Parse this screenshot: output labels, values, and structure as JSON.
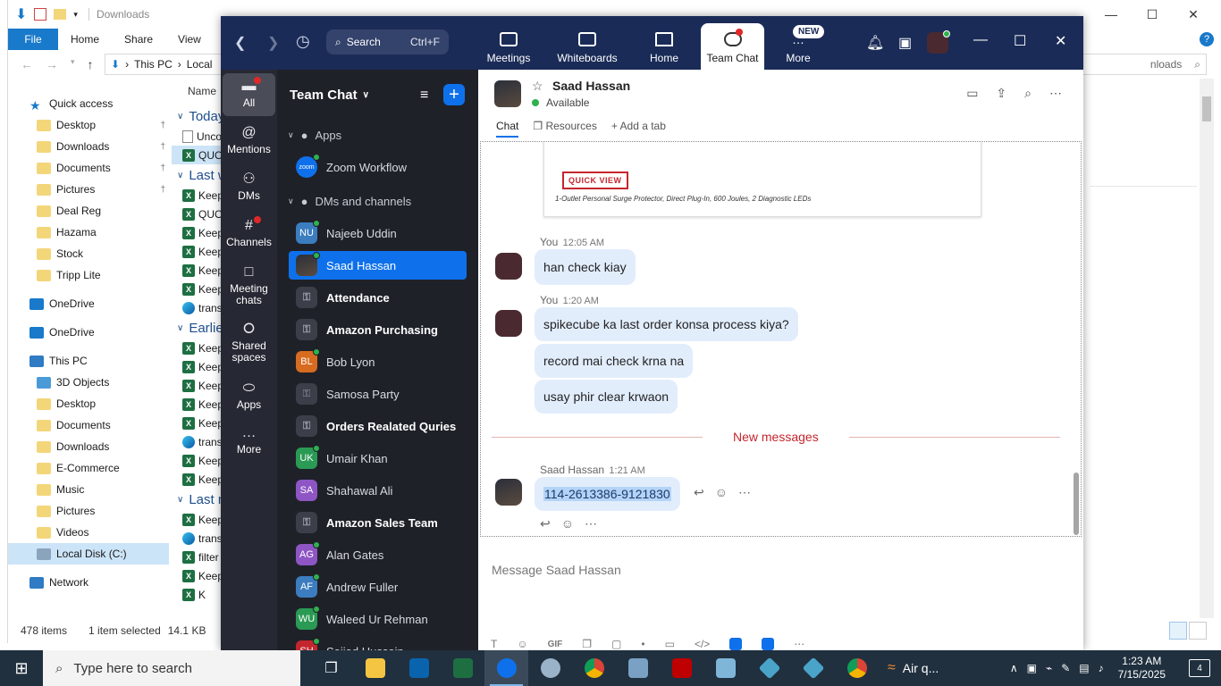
{
  "explorer": {
    "title": "Downloads",
    "ribbon_tabs": [
      "File",
      "Home",
      "Share",
      "View"
    ],
    "help_icon": "?",
    "address": [
      "This PC",
      "Local"
    ],
    "search_placeholder": "nloads",
    "nav": [
      {
        "label": "Quick access",
        "icon": "star-icon",
        "sub": false
      },
      {
        "label": "Desktop",
        "icon": "desktop-folder-icon",
        "sub": true,
        "pinned": true
      },
      {
        "label": "Downloads",
        "icon": "downloads-folder-icon",
        "sub": true,
        "pinned": true
      },
      {
        "label": "Documents",
        "icon": "documents-folder-icon",
        "sub": true,
        "pinned": true
      },
      {
        "label": "Pictures",
        "icon": "pictures-folder-icon",
        "sub": true,
        "pinned": true
      },
      {
        "label": "Deal Reg",
        "icon": "folder-icon",
        "sub": true
      },
      {
        "label": "Hazama",
        "icon": "folder-icon",
        "sub": true
      },
      {
        "label": "Stock",
        "icon": "folder-icon",
        "sub": true
      },
      {
        "label": "Tripp Lite",
        "icon": "folder-icon",
        "sub": true
      },
      {
        "label": "OneDrive",
        "icon": "cloud-icon",
        "sub": false
      },
      {
        "label": "OneDrive",
        "icon": "cloud-icon",
        "sub": false
      },
      {
        "label": "This PC",
        "icon": "pc-icon",
        "sub": false
      },
      {
        "label": "3D Objects",
        "icon": "3d-objects-icon",
        "sub": true
      },
      {
        "label": "Desktop",
        "icon": "desktop-folder-icon",
        "sub": true
      },
      {
        "label": "Documents",
        "icon": "documents-folder-icon",
        "sub": true
      },
      {
        "label": "Downloads",
        "icon": "downloads-folder-icon",
        "sub": true
      },
      {
        "label": "E-Commerce",
        "icon": "folder-icon",
        "sub": true
      },
      {
        "label": "Music",
        "icon": "music-folder-icon",
        "sub": true
      },
      {
        "label": "Pictures",
        "icon": "pictures-folder-icon",
        "sub": true
      },
      {
        "label": "Videos",
        "icon": "videos-folder-icon",
        "sub": true
      },
      {
        "label": "Local Disk (C:)",
        "icon": "drive-icon",
        "sub": true,
        "selected": true
      },
      {
        "label": "Network",
        "icon": "network-icon",
        "sub": false
      }
    ],
    "list_header": "Name",
    "groups": {
      "today": "Today",
      "last_week": "Last w",
      "earlier": "Earlie",
      "last_month": "Last m"
    },
    "today_items": [
      {
        "label": "Unco",
        "type": "file"
      },
      {
        "label": "QUO",
        "type": "xl",
        "selected": true
      }
    ],
    "last_week_items": [
      {
        "label": "Keep",
        "type": "xl"
      },
      {
        "label": "QUO",
        "type": "xl"
      },
      {
        "label": "Keep",
        "type": "xl"
      },
      {
        "label": "Keep",
        "type": "xl"
      },
      {
        "label": "Keep",
        "type": "xl"
      },
      {
        "label": "Keep",
        "type": "xl"
      },
      {
        "label": "trans",
        "type": "edge"
      }
    ],
    "earlier_items": [
      {
        "label": "Keep",
        "type": "xl"
      },
      {
        "label": "Keep",
        "type": "xl"
      },
      {
        "label": "Keep",
        "type": "xl"
      },
      {
        "label": "Keep",
        "type": "xl"
      },
      {
        "label": "Keep",
        "type": "xl"
      },
      {
        "label": "trans",
        "type": "edge"
      },
      {
        "label": "Keep",
        "type": "xl"
      },
      {
        "label": "Keep",
        "type": "xl"
      }
    ],
    "last_month_items": [
      {
        "label": "Keep",
        "type": "xl"
      },
      {
        "label": "trans",
        "type": "edge"
      },
      {
        "label": "filter",
        "type": "xl"
      },
      {
        "label": "Keep",
        "type": "xl"
      },
      {
        "label": "K",
        "type": "xl"
      }
    ],
    "status": {
      "count": "478 items",
      "selected": "1 item selected",
      "size": "14.1 KB"
    }
  },
  "zoom": {
    "search_label": "Search",
    "search_shortcut": "Ctrl+F",
    "tabs": [
      {
        "label": "Meetings",
        "icon": "video-camera-icon"
      },
      {
        "label": "Whiteboards",
        "icon": "whiteboard-icon"
      },
      {
        "label": "Home",
        "icon": "home-icon"
      },
      {
        "label": "Team Chat",
        "icon": "chat-bubble-icon",
        "active": true
      },
      {
        "label": "More",
        "icon": "more-icon"
      }
    ],
    "new_badge": "NEW",
    "rail": [
      {
        "label": "All",
        "icon": "chat-icon",
        "active": true
      },
      {
        "label": "Mentions",
        "icon": "at-icon"
      },
      {
        "label": "DMs",
        "icon": "people-icon"
      },
      {
        "label": "Channels",
        "icon": "hash-icon"
      },
      {
        "label": "Meeting chats",
        "icon": "calendar-icon"
      },
      {
        "label": "Shared spaces",
        "icon": "shared-icon"
      },
      {
        "label": "Apps",
        "icon": "apps-icon"
      },
      {
        "label": "More",
        "icon": "ellipsis-icon"
      }
    ],
    "list_title": "Team Chat",
    "sections": {
      "apps": "Apps",
      "dms": "DMs and channels"
    },
    "apps": [
      {
        "label": "Zoom Workflow",
        "badge": "zoom"
      }
    ],
    "contacts": [
      {
        "label": "Najeeb Uddin",
        "initials": "NU",
        "color": "#3b7dbf",
        "kind": "person",
        "online": true
      },
      {
        "label": "Saad Hassan",
        "initials": "",
        "color": "#444",
        "kind": "photo",
        "online": true,
        "selected": true
      },
      {
        "label": "Attendance",
        "kind": "channel",
        "bold": true
      },
      {
        "label": "Amazon Purchasing",
        "kind": "channel",
        "bold": true
      },
      {
        "label": "Bob Lyon",
        "initials": "BL",
        "color": "#d76b1f",
        "kind": "person",
        "online": true
      },
      {
        "label": "Samosa Party",
        "kind": "channel"
      },
      {
        "label": "Orders Realated Quries",
        "kind": "channel",
        "bold": true
      },
      {
        "label": "Umair Khan",
        "initials": "UK",
        "color": "#2a9a54",
        "kind": "person",
        "online": true
      },
      {
        "label": "Shahawal Ali",
        "initials": "SA",
        "color": "#8e55c4",
        "kind": "person",
        "online": false
      },
      {
        "label": "Amazon Sales Team",
        "kind": "channel",
        "bold": true
      },
      {
        "label": "Alan Gates",
        "initials": "AG",
        "color": "#8e55c4",
        "kind": "person",
        "online": true
      },
      {
        "label": "Andrew Fuller",
        "initials": "AF",
        "color": "#3b7dbf",
        "kind": "person",
        "online": true
      },
      {
        "label": "Waleed Ur Rehman",
        "initials": "WU",
        "color": "#2a9a54",
        "kind": "person",
        "online": true
      },
      {
        "label": "Sajjad Hussain",
        "initials": "SH",
        "color": "#c4262e",
        "kind": "person",
        "online": true
      }
    ],
    "chat": {
      "name": "Saad Hassan",
      "status": "Available",
      "tabs": [
        "Chat",
        "Resources",
        "Add a tab"
      ],
      "quick_view": "QUICK VIEW",
      "product_desc": "1-Outlet Personal Surge Protector, Direct Plug-In, 600 Joules, 2 Diagnostic LEDs",
      "messages": [
        {
          "sender": "You",
          "time": "12:05 AM",
          "lines": [
            "han check kiay"
          ]
        },
        {
          "sender": "You",
          "time": "1:20 AM",
          "lines": [
            "spikecube ka last order konsa process kiya?",
            "record mai check krna na",
            "usay phir clear krwaon"
          ]
        },
        {
          "sender": "Saad Hassan",
          "time": "1:21 AM",
          "lines": [
            "114-2613386-9121830"
          ]
        }
      ],
      "new_messages": "New messages",
      "compose_placeholder": "Message Saad Hassan",
      "gif_label": "GIF"
    }
  },
  "taskbar": {
    "search_placeholder": "Type here to search",
    "weather": "Air q...",
    "time": "1:23 AM",
    "date": "7/15/2025",
    "notifications": "4"
  }
}
